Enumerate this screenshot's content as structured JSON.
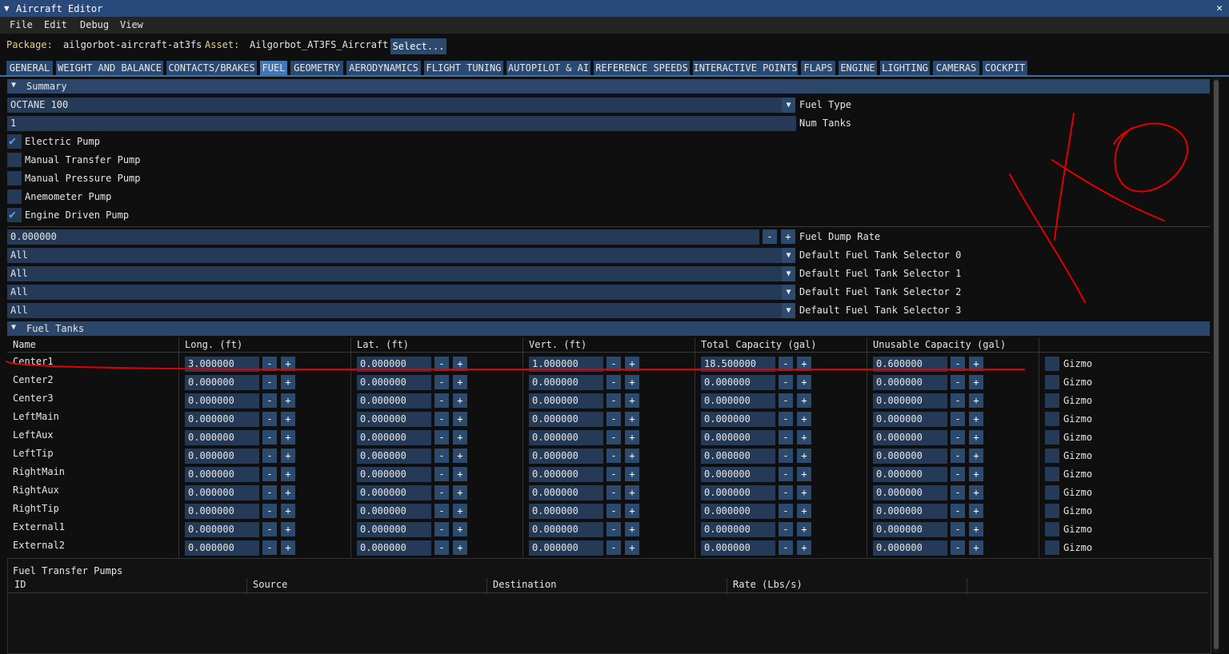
{
  "window": {
    "title": "Aircraft Editor",
    "close_icon": "close-icon"
  },
  "menu": [
    "File",
    "Edit",
    "Debug",
    "View"
  ],
  "package": {
    "label": "Package:",
    "value": "ailgorbot-aircraft-at3fs",
    "asset_label": "Asset:",
    "asset_value": "Ailgorbot_AT3FS_Aircraft",
    "select_label": "Select..."
  },
  "tabs": [
    "GENERAL",
    "WEIGHT AND BALANCE",
    "CONTACTS/BRAKES",
    "FUEL",
    "GEOMETRY",
    "AERODYNAMICS",
    "FLIGHT TUNING",
    "AUTOPILOT & AI",
    "REFERENCE SPEEDS",
    "INTERACTIVE POINTS",
    "FLAPS",
    "ENGINE",
    "LIGHTING",
    "CAMERAS",
    "COCKPIT"
  ],
  "active_tab": "FUEL",
  "summary": {
    "header": "Summary",
    "fuel_type": {
      "value": "OCTANE 100",
      "label": "Fuel Type"
    },
    "num_tanks": {
      "value": "1",
      "label": "Num Tanks"
    },
    "pumps": [
      {
        "label": "Electric Pump",
        "checked": true
      },
      {
        "label": "Manual Transfer Pump",
        "checked": false
      },
      {
        "label": "Manual Pressure Pump",
        "checked": false
      },
      {
        "label": "Anemometer Pump",
        "checked": false
      },
      {
        "label": "Engine Driven Pump",
        "checked": true
      }
    ],
    "fuel_dump_rate": {
      "value": "0.000000",
      "label": "Fuel Dump Rate",
      "minus": "-",
      "plus": "+"
    },
    "selectors": [
      {
        "value": "All",
        "label": "Default Fuel Tank Selector 0"
      },
      {
        "value": "All",
        "label": "Default Fuel Tank Selector 1"
      },
      {
        "value": "All",
        "label": "Default Fuel Tank Selector 2"
      },
      {
        "value": "All",
        "label": "Default Fuel Tank Selector 3"
      }
    ]
  },
  "fuel_tanks": {
    "header": "Fuel Tanks",
    "columns": [
      "Name",
      "Long. (ft)",
      "Lat. (ft)",
      "Vert. (ft)",
      "Total Capacity (gal)",
      "Unusable Capacity (gal)"
    ],
    "gizmo_label": "Gizmo",
    "minus": "-",
    "plus": "+",
    "rows": [
      {
        "name": "Center1",
        "values": [
          "3.000000",
          "0.000000",
          "1.000000",
          "18.500000",
          "0.600000"
        ]
      },
      {
        "name": "Center2",
        "values": [
          "0.000000",
          "0.000000",
          "0.000000",
          "0.000000",
          "0.000000"
        ]
      },
      {
        "name": "Center3",
        "values": [
          "0.000000",
          "0.000000",
          "0.000000",
          "0.000000",
          "0.000000"
        ]
      },
      {
        "name": "LeftMain",
        "values": [
          "0.000000",
          "0.000000",
          "0.000000",
          "0.000000",
          "0.000000"
        ]
      },
      {
        "name": "LeftAux",
        "values": [
          "0.000000",
          "0.000000",
          "0.000000",
          "0.000000",
          "0.000000"
        ]
      },
      {
        "name": "LeftTip",
        "values": [
          "0.000000",
          "0.000000",
          "0.000000",
          "0.000000",
          "0.000000"
        ]
      },
      {
        "name": "RightMain",
        "values": [
          "0.000000",
          "0.000000",
          "0.000000",
          "0.000000",
          "0.000000"
        ]
      },
      {
        "name": "RightAux",
        "values": [
          "0.000000",
          "0.000000",
          "0.000000",
          "0.000000",
          "0.000000"
        ]
      },
      {
        "name": "RightTip",
        "values": [
          "0.000000",
          "0.000000",
          "0.000000",
          "0.000000",
          "0.000000"
        ]
      },
      {
        "name": "External1",
        "values": [
          "0.000000",
          "0.000000",
          "0.000000",
          "0.000000",
          "0.000000"
        ]
      },
      {
        "name": "External2",
        "values": [
          "0.000000",
          "0.000000",
          "0.000000",
          "0.000000",
          "0.000000"
        ]
      }
    ]
  },
  "fuel_transfer_pumps": {
    "title": "Fuel Transfer Pumps",
    "columns": [
      "ID",
      "Source",
      "Destination",
      "Rate (Lbs/s)"
    ]
  },
  "colors": {
    "accent": "#4177b8",
    "frame": "#243a57",
    "annotation": "#e00000"
  }
}
